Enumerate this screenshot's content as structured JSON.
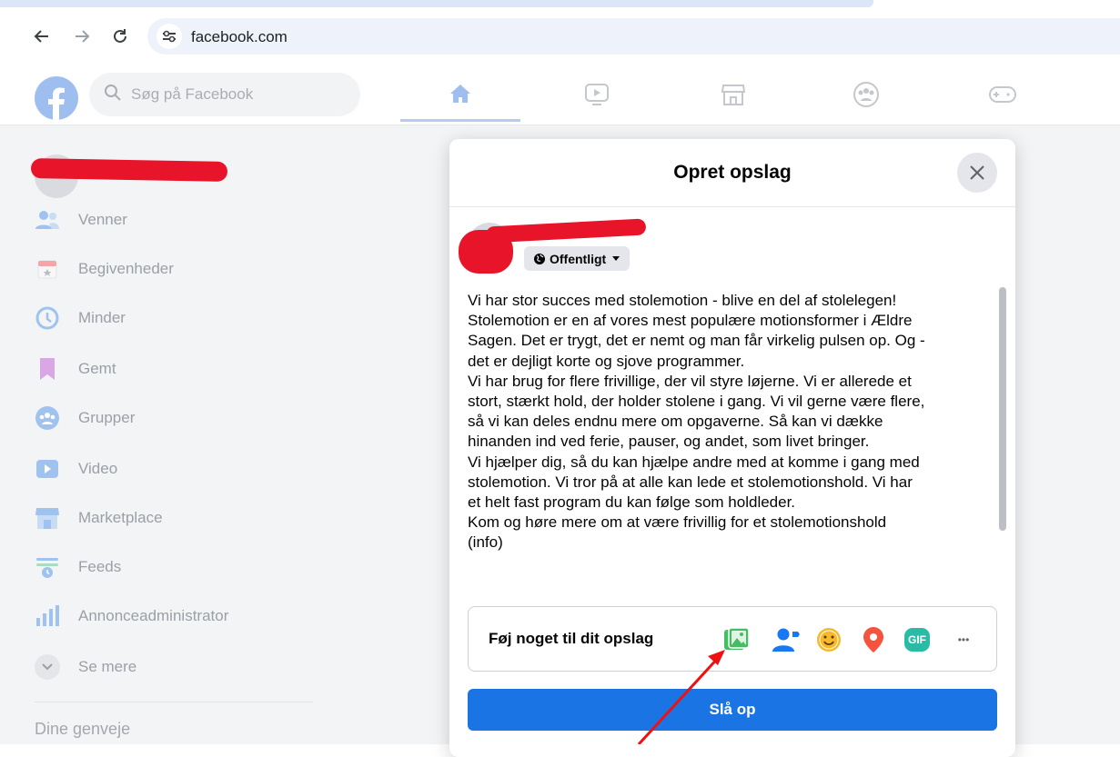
{
  "browser": {
    "url": "facebook.com",
    "back_icon": "arrow-left-icon",
    "forward_icon": "arrow-right-icon",
    "reload_icon": "reload-icon",
    "site_info_icon": "site-settings-icon"
  },
  "fb_header": {
    "search_placeholder": "Søg på Facebook",
    "tabs": [
      "home-icon",
      "video-icon",
      "marketplace-icon",
      "groups-icon",
      "gaming-icon"
    ]
  },
  "sidebar": {
    "items": [
      {
        "label": "Venner",
        "icon": "friends-icon"
      },
      {
        "label": "Begivenheder",
        "icon": "events-icon"
      },
      {
        "label": "Minder",
        "icon": "memories-icon"
      },
      {
        "label": "Gemt",
        "icon": "saved-icon"
      },
      {
        "label": "Grupper",
        "icon": "groups-icon"
      },
      {
        "label": "Video",
        "icon": "video-icon"
      },
      {
        "label": "Marketplace",
        "icon": "marketplace-icon"
      },
      {
        "label": "Feeds",
        "icon": "feeds-icon"
      },
      {
        "label": "Annonceadministrator",
        "icon": "ads-manager-icon"
      },
      {
        "label": "Se mere",
        "icon": "chevron-down-icon"
      }
    ],
    "shortcuts_title": "Dine genveje"
  },
  "modal": {
    "title": "Opret opslag",
    "privacy_label": "Offentligt",
    "post_text": "Vi har stor succes med stolemotion - blive en del af stolelegen!\nStolemotion er en af vores mest populære motionsformer i Ældre\nSagen. Det er trygt, det er nemt og man får virkelig pulsen op. Og -\ndet er dejligt korte og sjove programmer.\nVi har brug for flere frivillige, der vil styre løjerne. Vi er allerede et\nstort, stærkt hold, der holder stolene i gang. Vi vil gerne være flere,\nså vi kan deles endnu mere om opgaverne. Så kan vi dække\nhinanden ind ved ferie, pauser, og andet, som livet bringer.\nVi hjælper dig, så du kan hjælpe andre med at komme i gang med\nstolemotion. Vi tror på at alle kan lede et stolemotionshold. Vi har\net helt fast program du kan følge som holdleder.\nKom og høre mere om at være frivillig for et stolemotionshold\n(info)",
    "add_to_post_label": "Føj noget til dit opslag",
    "add_icons": [
      "photo-video-icon",
      "tag-people-icon",
      "feeling-icon",
      "location-icon",
      "gif-icon",
      "more-icon"
    ],
    "gif_text": "GIF",
    "more_text": "•••",
    "submit_label": "Slå op"
  },
  "colors": {
    "primary": "#1b74e4",
    "redaction": "#e8152a",
    "annotation_arrow": "#ee1111"
  }
}
